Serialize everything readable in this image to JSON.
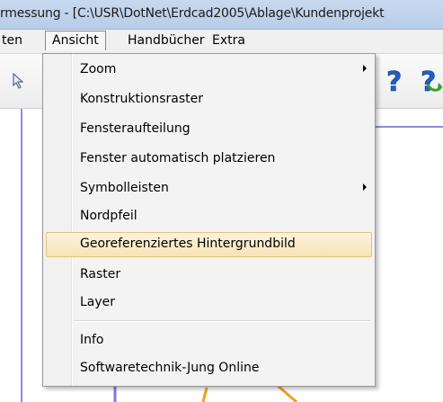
{
  "window": {
    "title": "rmessung - [C:\\USR\\DotNet\\Erdcad2005\\Ablage\\Kundenprojekt"
  },
  "menubar": {
    "items": [
      {
        "label": "ten"
      },
      {
        "label": "Ansicht"
      },
      {
        "label": "Handbücher"
      },
      {
        "label": "Extra"
      }
    ]
  },
  "toolbar": {
    "icons": [
      "cursor-arrow-icon",
      "help-question-icon",
      "help-refresh-icon"
    ]
  },
  "menu": {
    "items": [
      {
        "label": "Zoom"
      },
      {
        "label": "Konstruktionsraster"
      },
      {
        "label": "Fensteraufteilung"
      },
      {
        "label": "Fenster automatisch platzieren"
      },
      {
        "label": "Symbolleisten"
      },
      {
        "label": "Nordpfeil"
      },
      {
        "label": "Georeferenziertes Hintergrundbild"
      },
      {
        "label": "Raster"
      },
      {
        "label": "Layer"
      },
      {
        "label": "Info"
      },
      {
        "label": "Softwaretechnik-Jung Online"
      }
    ],
    "highlighted_index": 6,
    "highlight_color": "#fbeec8"
  }
}
